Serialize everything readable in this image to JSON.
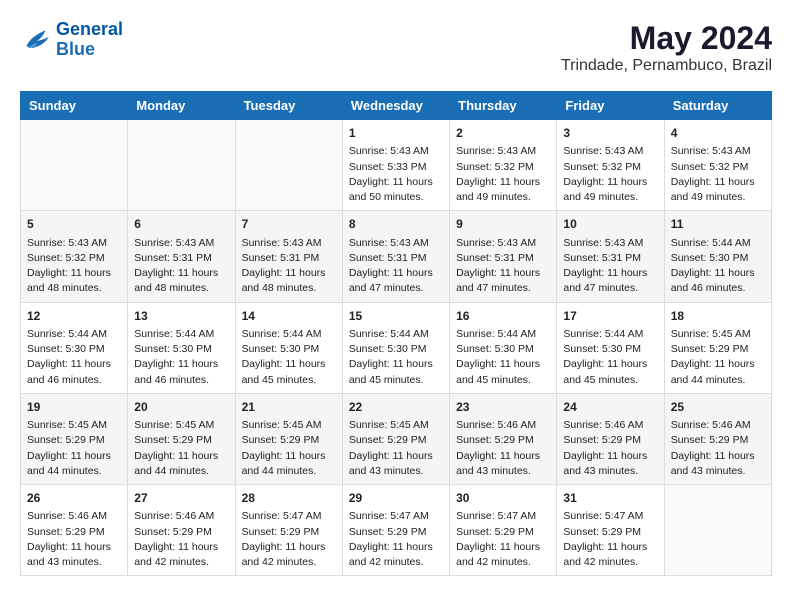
{
  "header": {
    "logo_line1": "General",
    "logo_line2": "Blue",
    "month_year": "May 2024",
    "location": "Trindade, Pernambuco, Brazil"
  },
  "days_of_week": [
    "Sunday",
    "Monday",
    "Tuesday",
    "Wednesday",
    "Thursday",
    "Friday",
    "Saturday"
  ],
  "weeks": [
    [
      {
        "day": "",
        "sunrise": "",
        "sunset": "",
        "daylight": ""
      },
      {
        "day": "",
        "sunrise": "",
        "sunset": "",
        "daylight": ""
      },
      {
        "day": "",
        "sunrise": "",
        "sunset": "",
        "daylight": ""
      },
      {
        "day": "1",
        "sunrise": "Sunrise: 5:43 AM",
        "sunset": "Sunset: 5:33 PM",
        "daylight": "Daylight: 11 hours and 50 minutes."
      },
      {
        "day": "2",
        "sunrise": "Sunrise: 5:43 AM",
        "sunset": "Sunset: 5:32 PM",
        "daylight": "Daylight: 11 hours and 49 minutes."
      },
      {
        "day": "3",
        "sunrise": "Sunrise: 5:43 AM",
        "sunset": "Sunset: 5:32 PM",
        "daylight": "Daylight: 11 hours and 49 minutes."
      },
      {
        "day": "4",
        "sunrise": "Sunrise: 5:43 AM",
        "sunset": "Sunset: 5:32 PM",
        "daylight": "Daylight: 11 hours and 49 minutes."
      }
    ],
    [
      {
        "day": "5",
        "sunrise": "Sunrise: 5:43 AM",
        "sunset": "Sunset: 5:32 PM",
        "daylight": "Daylight: 11 hours and 48 minutes."
      },
      {
        "day": "6",
        "sunrise": "Sunrise: 5:43 AM",
        "sunset": "Sunset: 5:31 PM",
        "daylight": "Daylight: 11 hours and 48 minutes."
      },
      {
        "day": "7",
        "sunrise": "Sunrise: 5:43 AM",
        "sunset": "Sunset: 5:31 PM",
        "daylight": "Daylight: 11 hours and 48 minutes."
      },
      {
        "day": "8",
        "sunrise": "Sunrise: 5:43 AM",
        "sunset": "Sunset: 5:31 PM",
        "daylight": "Daylight: 11 hours and 47 minutes."
      },
      {
        "day": "9",
        "sunrise": "Sunrise: 5:43 AM",
        "sunset": "Sunset: 5:31 PM",
        "daylight": "Daylight: 11 hours and 47 minutes."
      },
      {
        "day": "10",
        "sunrise": "Sunrise: 5:43 AM",
        "sunset": "Sunset: 5:31 PM",
        "daylight": "Daylight: 11 hours and 47 minutes."
      },
      {
        "day": "11",
        "sunrise": "Sunrise: 5:44 AM",
        "sunset": "Sunset: 5:30 PM",
        "daylight": "Daylight: 11 hours and 46 minutes."
      }
    ],
    [
      {
        "day": "12",
        "sunrise": "Sunrise: 5:44 AM",
        "sunset": "Sunset: 5:30 PM",
        "daylight": "Daylight: 11 hours and 46 minutes."
      },
      {
        "day": "13",
        "sunrise": "Sunrise: 5:44 AM",
        "sunset": "Sunset: 5:30 PM",
        "daylight": "Daylight: 11 hours and 46 minutes."
      },
      {
        "day": "14",
        "sunrise": "Sunrise: 5:44 AM",
        "sunset": "Sunset: 5:30 PM",
        "daylight": "Daylight: 11 hours and 45 minutes."
      },
      {
        "day": "15",
        "sunrise": "Sunrise: 5:44 AM",
        "sunset": "Sunset: 5:30 PM",
        "daylight": "Daylight: 11 hours and 45 minutes."
      },
      {
        "day": "16",
        "sunrise": "Sunrise: 5:44 AM",
        "sunset": "Sunset: 5:30 PM",
        "daylight": "Daylight: 11 hours and 45 minutes."
      },
      {
        "day": "17",
        "sunrise": "Sunrise: 5:44 AM",
        "sunset": "Sunset: 5:30 PM",
        "daylight": "Daylight: 11 hours and 45 minutes."
      },
      {
        "day": "18",
        "sunrise": "Sunrise: 5:45 AM",
        "sunset": "Sunset: 5:29 PM",
        "daylight": "Daylight: 11 hours and 44 minutes."
      }
    ],
    [
      {
        "day": "19",
        "sunrise": "Sunrise: 5:45 AM",
        "sunset": "Sunset: 5:29 PM",
        "daylight": "Daylight: 11 hours and 44 minutes."
      },
      {
        "day": "20",
        "sunrise": "Sunrise: 5:45 AM",
        "sunset": "Sunset: 5:29 PM",
        "daylight": "Daylight: 11 hours and 44 minutes."
      },
      {
        "day": "21",
        "sunrise": "Sunrise: 5:45 AM",
        "sunset": "Sunset: 5:29 PM",
        "daylight": "Daylight: 11 hours and 44 minutes."
      },
      {
        "day": "22",
        "sunrise": "Sunrise: 5:45 AM",
        "sunset": "Sunset: 5:29 PM",
        "daylight": "Daylight: 11 hours and 43 minutes."
      },
      {
        "day": "23",
        "sunrise": "Sunrise: 5:46 AM",
        "sunset": "Sunset: 5:29 PM",
        "daylight": "Daylight: 11 hours and 43 minutes."
      },
      {
        "day": "24",
        "sunrise": "Sunrise: 5:46 AM",
        "sunset": "Sunset: 5:29 PM",
        "daylight": "Daylight: 11 hours and 43 minutes."
      },
      {
        "day": "25",
        "sunrise": "Sunrise: 5:46 AM",
        "sunset": "Sunset: 5:29 PM",
        "daylight": "Daylight: 11 hours and 43 minutes."
      }
    ],
    [
      {
        "day": "26",
        "sunrise": "Sunrise: 5:46 AM",
        "sunset": "Sunset: 5:29 PM",
        "daylight": "Daylight: 11 hours and 43 minutes."
      },
      {
        "day": "27",
        "sunrise": "Sunrise: 5:46 AM",
        "sunset": "Sunset: 5:29 PM",
        "daylight": "Daylight: 11 hours and 42 minutes."
      },
      {
        "day": "28",
        "sunrise": "Sunrise: 5:47 AM",
        "sunset": "Sunset: 5:29 PM",
        "daylight": "Daylight: 11 hours and 42 minutes."
      },
      {
        "day": "29",
        "sunrise": "Sunrise: 5:47 AM",
        "sunset": "Sunset: 5:29 PM",
        "daylight": "Daylight: 11 hours and 42 minutes."
      },
      {
        "day": "30",
        "sunrise": "Sunrise: 5:47 AM",
        "sunset": "Sunset: 5:29 PM",
        "daylight": "Daylight: 11 hours and 42 minutes."
      },
      {
        "day": "31",
        "sunrise": "Sunrise: 5:47 AM",
        "sunset": "Sunset: 5:29 PM",
        "daylight": "Daylight: 11 hours and 42 minutes."
      },
      {
        "day": "",
        "sunrise": "",
        "sunset": "",
        "daylight": ""
      }
    ]
  ]
}
